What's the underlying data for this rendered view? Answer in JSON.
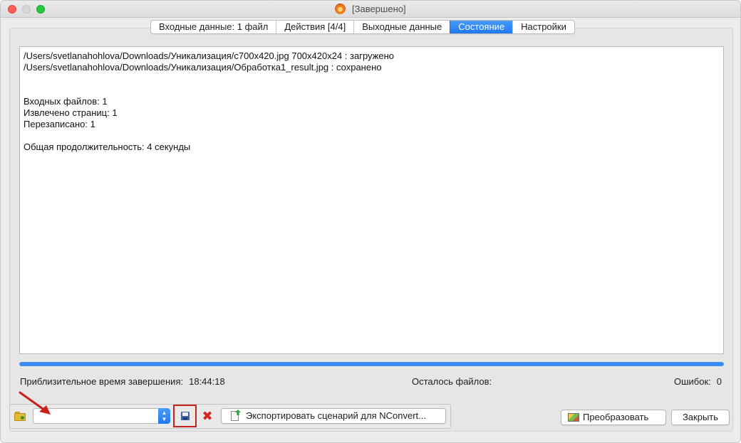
{
  "window": {
    "title": "[Завершено]"
  },
  "tabs": [
    {
      "label": "Входные данные: 1 файл",
      "active": false
    },
    {
      "label": "Действия [4/4]",
      "active": false
    },
    {
      "label": "Выходные данные",
      "active": false
    },
    {
      "label": "Состояние",
      "active": true
    },
    {
      "label": "Настройки",
      "active": false
    }
  ],
  "log": {
    "lines": [
      "/Users/svetlanahohlova/Downloads/Уникализация/c700x420.jpg 700x420x24 : загружено",
      "/Users/svetlanahohlova/Downloads/Уникализация/Обработка1_result.jpg : сохранено",
      "",
      "",
      "Входных файлов: 1",
      "Извлечено страниц: 1",
      "Перезаписано: 1",
      "",
      "Общая продолжительность: 4 секунды"
    ]
  },
  "progress": {
    "percent": 100
  },
  "status": {
    "time_label": "Приблизительное время завершения:",
    "time_value": "18:44:18",
    "files_left_label": "Осталось файлов:",
    "errors_label": "Ошибок:",
    "errors_value": "0"
  },
  "toolbar": {
    "preset_value": "",
    "export_label": "Экспортировать сценарий для NConvert..."
  },
  "buttons": {
    "convert_label": "Преобразовать",
    "close_label": "Закрыть"
  },
  "icons": {
    "folder": "folder-icon",
    "save": "floppy-disk-icon",
    "delete": "red-x-icon",
    "export": "document-arrow-icon",
    "convert": "image-convert-icon",
    "app": "xnconvert-app-icon"
  },
  "colors": {
    "accent": "#1f78f2",
    "progress": "#3b8cf5",
    "highlight_box": "#c8221d",
    "annotation_arrow": "#c8221d",
    "delete_icon": "#d3261f"
  }
}
